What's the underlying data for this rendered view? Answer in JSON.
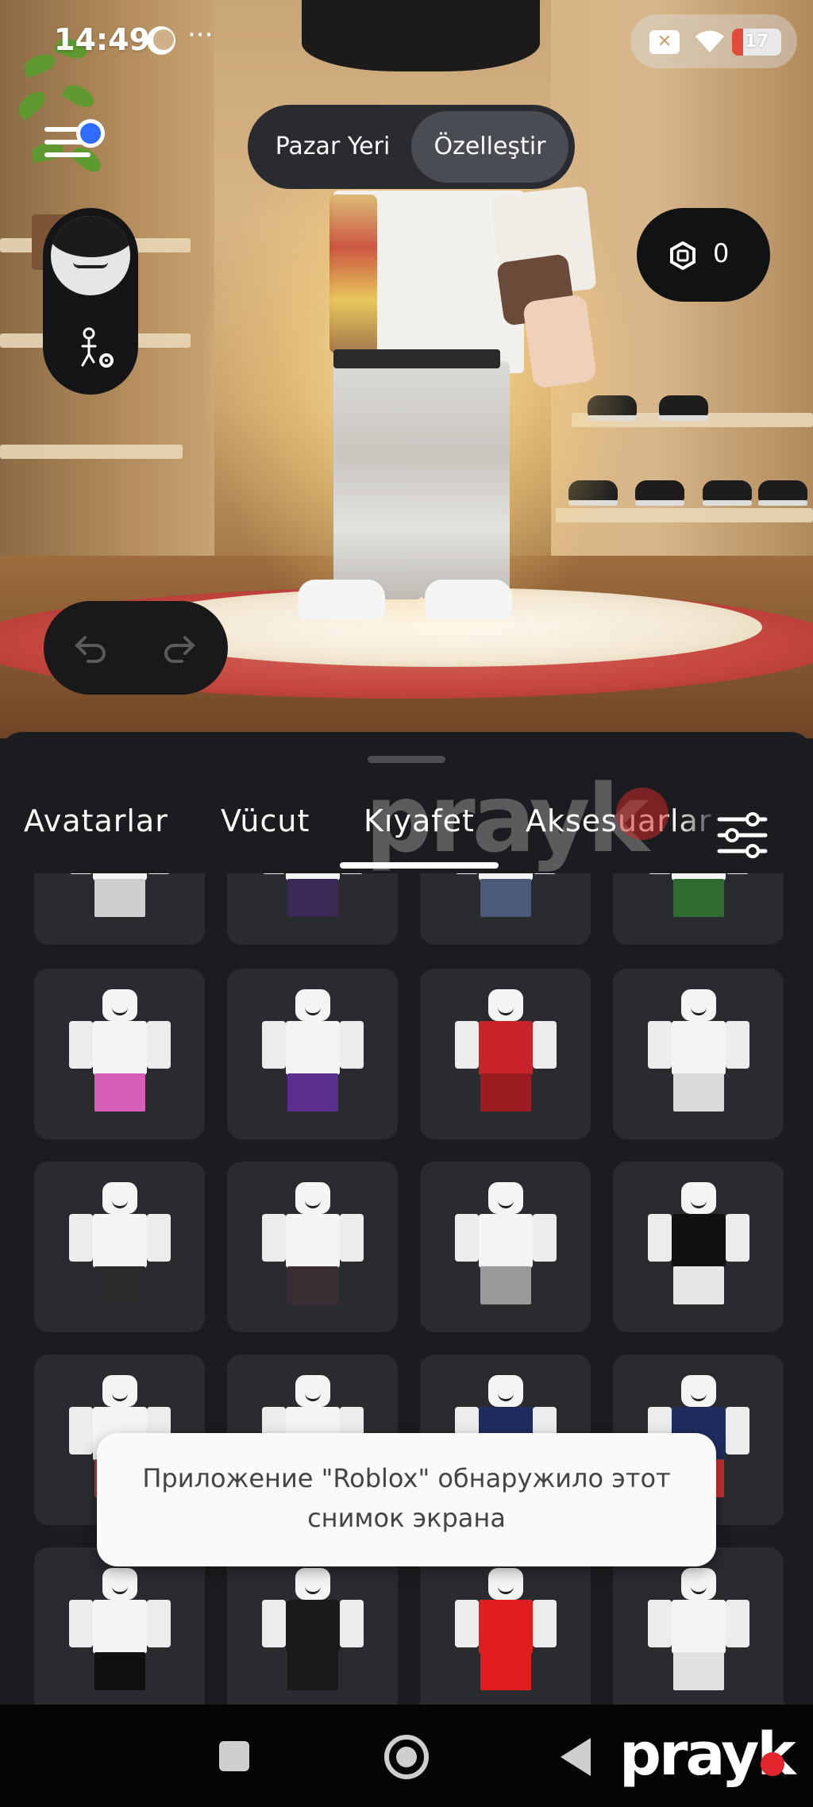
{
  "status_bar": {
    "time": "14:49",
    "dots": "···",
    "close_icon_glyph": "✕",
    "battery_level": "17",
    "battery_color": "#e04b3a"
  },
  "header": {
    "segments": [
      {
        "label": "Pazar Yeri",
        "active": false
      },
      {
        "label": "Özelleştir",
        "active": true
      }
    ],
    "robux_count": "0",
    "menu_notification_color": "#2f6bff"
  },
  "tabs": [
    {
      "label": "Avatarlar",
      "active": false
    },
    {
      "label": "Vücut",
      "active": false
    },
    {
      "label": "Kıyafet",
      "active": true
    },
    {
      "label": "Aksesuarlar",
      "active": false
    }
  ],
  "watermark": "prayk",
  "items": [
    {
      "shirt": "#f4f4f4",
      "legs": "#cfcfcf"
    },
    {
      "shirt": "#f4f4f4",
      "legs": "#3a2a55"
    },
    {
      "shirt": "#f4f4f4",
      "legs": "#4a5a78"
    },
    {
      "shirt": "#f4f4f4",
      "legs": "#2f6a2f"
    },
    {
      "shirt": "#f4f4f4",
      "legs": "#d85fb8"
    },
    {
      "shirt": "#f4f4f4",
      "legs": "#5a2e8e"
    },
    {
      "shirt": "#c8232a",
      "legs": "#9b1d22"
    },
    {
      "shirt": "#f4f4f4",
      "legs": "#d9d9d9"
    },
    {
      "shirt": "#f4f4f4",
      "legs": "#2b2b2e"
    },
    {
      "shirt": "#f4f4f4",
      "legs": "#3a2d33"
    },
    {
      "shirt": "#f4f4f4",
      "legs": "#9a9a9a"
    },
    {
      "shirt": "#111111",
      "legs": "#e6e6e6"
    },
    {
      "shirt": "#f4f4f4",
      "legs": "#c23030"
    },
    {
      "shirt": "#f4f4f4",
      "legs": "#b04a8a"
    },
    {
      "shirt": "#1e2c5e",
      "legs": "#1e2c5e"
    },
    {
      "shirt": "#1e2c5e",
      "legs": "#c23030"
    },
    {
      "shirt": "#f4f4f4",
      "legs": "#111111"
    },
    {
      "shirt": "#1a1a1a",
      "legs": "#1a1a1a"
    },
    {
      "shirt": "#e11d1d",
      "legs": "#e11d1d"
    },
    {
      "shirt": "#f4f4f4",
      "legs": "#e0e0e0"
    }
  ],
  "toast": {
    "line1": "Приложение \"Roblox\" обнаружило этот",
    "line2": "снимок экрана"
  },
  "navbar": {
    "brand": "prayk",
    "brand_dot_color": "#e3262b"
  }
}
